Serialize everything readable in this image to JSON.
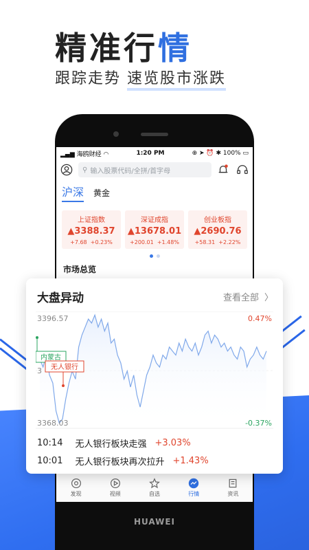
{
  "hero": {
    "title_main": "精准行",
    "title_accent": "情",
    "subtitle_a": "跟踪走势",
    "subtitle_b": "速览股市涨跌"
  },
  "phone": {
    "brand": "HUAWEI",
    "status": {
      "carrier": "海鸥财经",
      "time": "1:20 PM",
      "battery": "100%"
    },
    "search": {
      "placeholder": "输入股票代码/全拼/首字母"
    },
    "tabs": [
      "沪深",
      "黄金"
    ],
    "indices": [
      {
        "name": "上证指数",
        "value": "3388.37",
        "change": "+7.68",
        "pct": "+0.23%"
      },
      {
        "name": "深证成指",
        "value": "13678.01",
        "change": "+200.01",
        "pct": "+1.48%"
      },
      {
        "name": "创业板指",
        "value": "2690.76",
        "change": "+58.31",
        "pct": "+2.22%"
      }
    ],
    "section_heading": "市场总览",
    "nav": [
      {
        "label": "发现",
        "icon": "discover-icon"
      },
      {
        "label": "视频",
        "icon": "video-icon"
      },
      {
        "label": "自选",
        "icon": "star-icon"
      },
      {
        "label": "行情",
        "icon": "market-icon"
      },
      {
        "label": "资讯",
        "icon": "news-icon"
      }
    ],
    "active_nav": "行情"
  },
  "float_card": {
    "title": "大盘异动",
    "view_all": "查看全部",
    "chart_labels": {
      "y_max": "3396.57",
      "y_min": "3368.03",
      "pct_max": "0.47%",
      "pct_min": "-0.37%",
      "tag1": "内蒙古",
      "tag2": "无人银行",
      "midmark": "3"
    },
    "news": [
      {
        "time": "10:14",
        "text": "无人银行板块走强",
        "change": "+3.03%"
      },
      {
        "time": "10:01",
        "text": "无人银行板块再次拉升",
        "change": "+1.43%"
      }
    ]
  },
  "colors": {
    "accent": "#2f6fe0",
    "up": "#e0452d",
    "down": "#2aa45f",
    "line": "#7fa8ea"
  },
  "chart_data": {
    "type": "line",
    "ylim": [
      3368.03,
      3396.57
    ],
    "y_right_labels": [
      "0.47%",
      "-0.37%"
    ],
    "values": [
      3385,
      3383,
      3386,
      3381,
      3379,
      3372,
      3369,
      3370,
      3375,
      3379,
      3382,
      3380,
      3388,
      3391,
      3393,
      3395,
      3394,
      3396,
      3393,
      3395,
      3392,
      3394,
      3389,
      3390,
      3386,
      3384,
      3380,
      3382,
      3378,
      3381,
      3376,
      3373,
      3377,
      3381,
      3383,
      3386,
      3384,
      3383,
      3386,
      3385,
      3388,
      3387,
      3386,
      3389,
      3387,
      3390,
      3388,
      3387,
      3389,
      3386,
      3388,
      3391,
      3392,
      3389,
      3391,
      3390,
      3388,
      3389,
      3387,
      3388,
      3386,
      3385,
      3388,
      3387,
      3383,
      3385,
      3386,
      3388,
      3386,
      3385,
      3387
    ]
  }
}
